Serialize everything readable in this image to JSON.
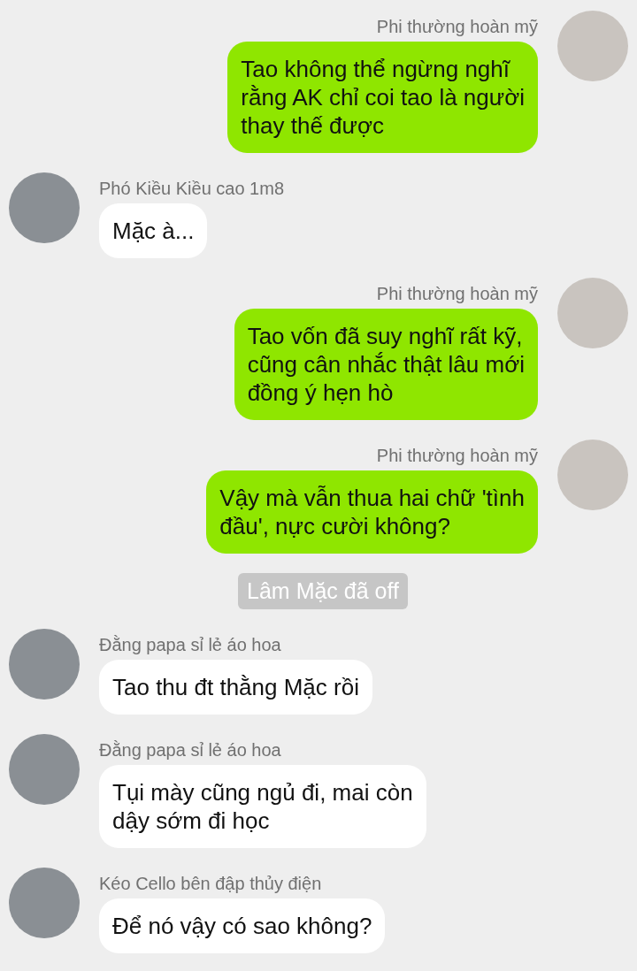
{
  "messages": [
    {
      "kind": "outgoing",
      "sender": "Phi thường hoàn mỹ",
      "text": "Tao không thể ngừng nghĩ\nrằng AK chỉ coi tao là người\nthay thế được"
    },
    {
      "kind": "incoming",
      "sender": "Phó Kiều Kiều cao 1m8",
      "text": "Mặc à..."
    },
    {
      "kind": "outgoing",
      "sender": "Phi thường hoàn mỹ",
      "text": "Tao vốn đã suy nghĩ rất kỹ,\ncũng cân nhắc thật lâu mới\nđồng ý hẹn hò"
    },
    {
      "kind": "outgoing",
      "sender": "Phi thường hoàn mỹ",
      "text": "Vậy mà vẫn thua hai chữ 'tình\nđầu', nực cười không?"
    },
    {
      "kind": "system",
      "text": "Lâm Mặc đã off"
    },
    {
      "kind": "incoming",
      "sender": "Đằng papa sỉ lẻ áo hoa",
      "text": "Tao thu đt thằng Mặc rồi"
    },
    {
      "kind": "incoming",
      "sender": "Đằng papa sỉ lẻ áo hoa",
      "text": "Tụi mày cũng ngủ đi, mai còn\ndậy sớm đi học"
    },
    {
      "kind": "incoming",
      "sender": "Kéo Cello bên đập thủy điện",
      "text": "Để nó vậy có sao không?"
    }
  ]
}
